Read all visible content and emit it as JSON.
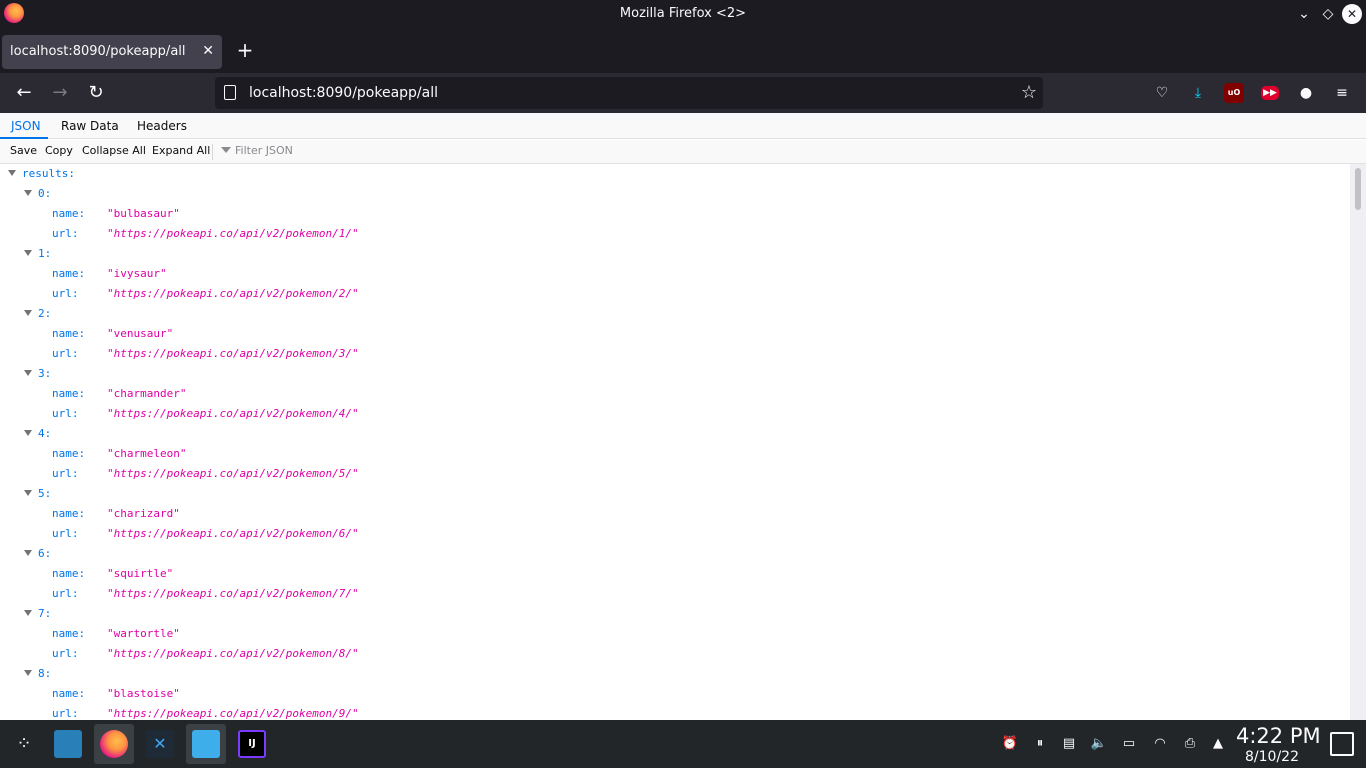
{
  "window": {
    "title": "Mozilla Firefox <2>"
  },
  "tab": {
    "title": "localhost:8090/pokeapp/all"
  },
  "urlbar": {
    "url": "localhost:8090/pokeapp/all"
  },
  "viewer": {
    "tabs": [
      "JSON",
      "Raw Data",
      "Headers"
    ],
    "toolbar": [
      "Save",
      "Copy",
      "Collapse All",
      "Expand All"
    ],
    "filter_placeholder": "Filter JSON"
  },
  "json": {
    "root_key": "results:",
    "name_key": "name:",
    "url_key": "url:",
    "items": [
      {
        "index": "0:",
        "name": "\"bulbasaur\"",
        "url": "\"https://pokeapi.co/api/v2/pokemon/1/\""
      },
      {
        "index": "1:",
        "name": "\"ivysaur\"",
        "url": "\"https://pokeapi.co/api/v2/pokemon/2/\""
      },
      {
        "index": "2:",
        "name": "\"venusaur\"",
        "url": "\"https://pokeapi.co/api/v2/pokemon/3/\""
      },
      {
        "index": "3:",
        "name": "\"charmander\"",
        "url": "\"https://pokeapi.co/api/v2/pokemon/4/\""
      },
      {
        "index": "4:",
        "name": "\"charmeleon\"",
        "url": "\"https://pokeapi.co/api/v2/pokemon/5/\""
      },
      {
        "index": "5:",
        "name": "\"charizard\"",
        "url": "\"https://pokeapi.co/api/v2/pokemon/6/\""
      },
      {
        "index": "6:",
        "name": "\"squirtle\"",
        "url": "\"https://pokeapi.co/api/v2/pokemon/7/\""
      },
      {
        "index": "7:",
        "name": "\"wartortle\"",
        "url": "\"https://pokeapi.co/api/v2/pokemon/8/\""
      },
      {
        "index": "8:",
        "name": "\"blastoise\"",
        "url": "\"https://pokeapi.co/api/v2/pokemon/9/\""
      }
    ]
  },
  "taskbar": {
    "time": "4:22 PM",
    "date": "8/10/22"
  },
  "colors": {
    "key": "#0074e8",
    "string": "#dd00a9",
    "chrome_dark": "#1c1b22",
    "toolbar": "#2b2a33",
    "taskbar": "#232629"
  }
}
